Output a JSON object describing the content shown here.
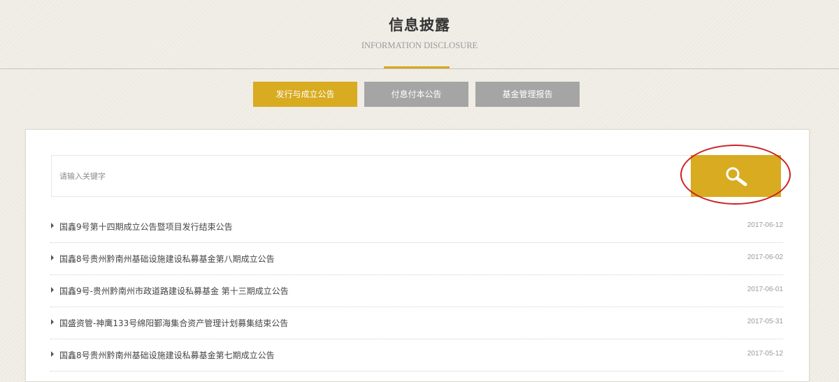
{
  "header": {
    "title": "信息披露",
    "subtitle": "INFORMATION DISCLOSURE"
  },
  "tabs": [
    {
      "label": "发行与成立公告",
      "active": true
    },
    {
      "label": "付息付本公告",
      "active": false
    },
    {
      "label": "基金管理报告",
      "active": false
    }
  ],
  "search": {
    "placeholder": "请输入关键字",
    "value": "",
    "button_icon": "search-icon"
  },
  "notices": [
    {
      "title": "国鑫9号第十四期成立公告暨项目发行结束公告",
      "date": "2017-06-12"
    },
    {
      "title": "国鑫8号贵州黔南州基础设施建设私募基金第八期成立公告",
      "date": "2017-06-02"
    },
    {
      "title": "国鑫9号-贵州黔南州市政道路建设私募基金 第十三期成立公告",
      "date": "2017-06-01"
    },
    {
      "title": "国盛资管-神鹰133号绵阳鄞海集合资产管理计划募集结束公告",
      "date": "2017-05-31"
    },
    {
      "title": "国鑫8号贵州黔南州基础设施建设私募基金第七期成立公告",
      "date": "2017-05-12"
    }
  ],
  "colors": {
    "accent": "#d8ab21",
    "tab_inactive": "#a5a5a5",
    "highlight": "#cc2222",
    "background": "#eeebe3"
  }
}
